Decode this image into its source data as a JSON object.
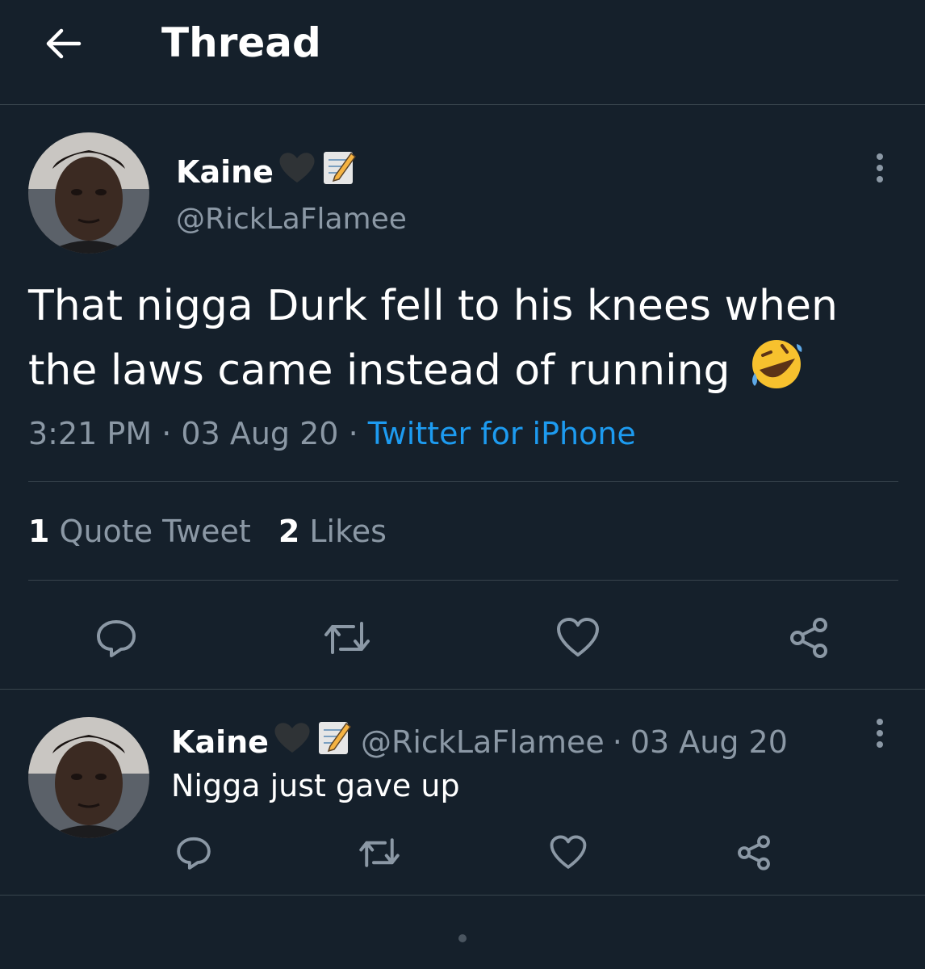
{
  "header": {
    "title": "Thread",
    "back_icon": "arrow-left-icon"
  },
  "main_tweet": {
    "author_name": "Kaine",
    "author_handle": "@RickLaFlamee",
    "text": "That nigga Durk fell to his knees when the laws came instead of running",
    "emoji": "rolling-on-floor-laughing-emoji",
    "time": "3:21 PM",
    "date": "03 Aug 20",
    "separator": "·",
    "source": "Twitter for iPhone",
    "quote_count": "1",
    "quote_label": "Quote Tweet",
    "like_count": "2",
    "like_label": "Likes"
  },
  "reply_tweet": {
    "author_name": "Kaine",
    "author_handle": "@RickLaFlamee",
    "separator": "·",
    "date": "03 Aug 20",
    "text": "Nigga just gave up"
  },
  "colors": {
    "background": "#15202b",
    "border": "#38444d",
    "secondary_text": "#8b98a5",
    "link": "#1d9bf0"
  }
}
